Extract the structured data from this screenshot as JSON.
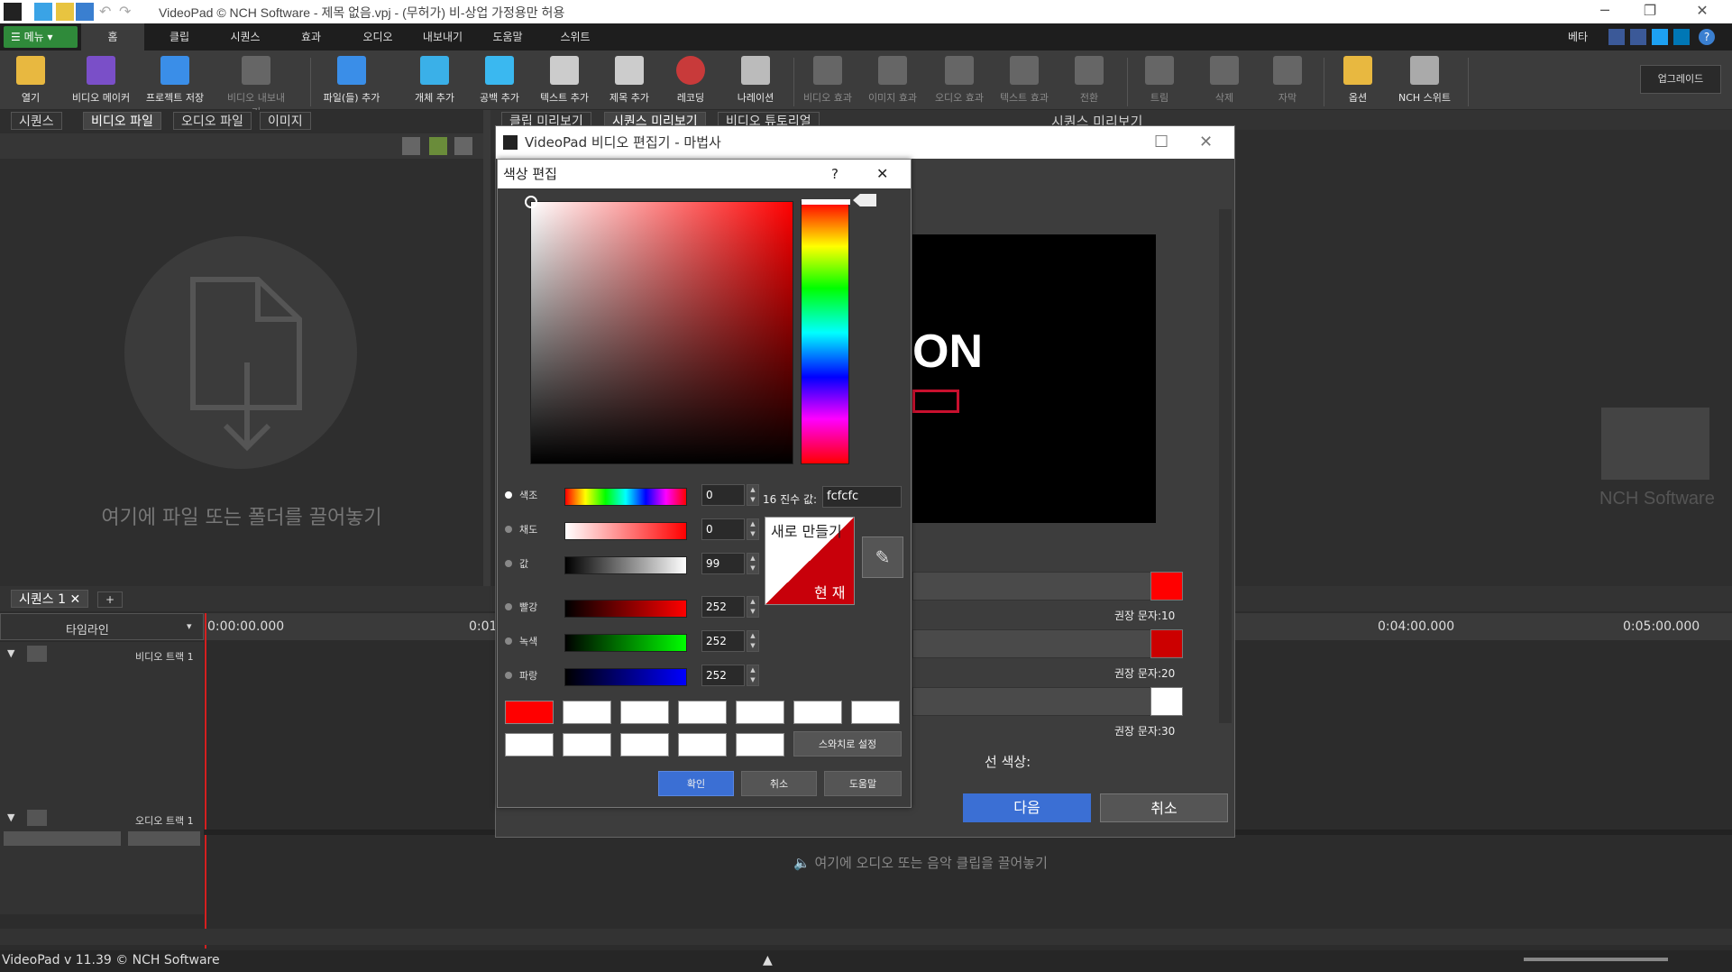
{
  "titlebar": {
    "title": "VideoPad © NCH Software - 제목 없음.vpj - (무허가) 비-상업 가정용만 허용"
  },
  "menu": {
    "label": "메뉴"
  },
  "tabs": [
    "홈",
    "클립",
    "시퀀스",
    "효과",
    "오디오",
    "내보내기",
    "도움말",
    "스위트"
  ],
  "header_right": {
    "beta": "베타"
  },
  "toolbar": {
    "items": [
      "열기",
      "비디오 메이커",
      "프로젝트 저장",
      "비디오 내보내기",
      "파일(들) 추가",
      "개체 추가",
      "공백 추가",
      "텍스트 추가",
      "제목 추가",
      "레코딩",
      "나레이션",
      "비디오 효과",
      "이미지 효과",
      "오디오 효과",
      "텍스트 효과",
      "전환",
      "트림",
      "삭제",
      "자막",
      "옵션",
      "NCH 스위트"
    ],
    "upgrade": "업그레이드"
  },
  "left_panel": {
    "tabs": [
      "시퀀스",
      "비디오 파일",
      "오디오 파일",
      "이미지"
    ],
    "drop_text": "여기에 파일 또는 폴더를 끌어놓기"
  },
  "right_panel": {
    "tabs": [
      "클립 미리보기",
      "시퀀스 미리보기",
      "비디오 튜토리얼"
    ],
    "title": "시퀀스 미리보기",
    "watermark": "NCH Software",
    "preview_text": "ON"
  },
  "timeline": {
    "tab": "시퀀스 1",
    "track_label": "타임라인",
    "ruler": [
      "0:00:00.000",
      "0:01",
      "0:04:00.000",
      "0:05:00.000"
    ],
    "video_track": "비디오 트랙 1",
    "audio_track": "오디오 트랙 1",
    "audio_drop": "여기에 오디오 또는 음악 클립을 끌어놓기"
  },
  "status": {
    "version": "VideoPad v 11.39 © NCH Software"
  },
  "wizard": {
    "title": "VideoPad 비디오 편집기 - 마법사",
    "captions": [
      "권장 문자:10",
      "권장 문자:20",
      "권장 문자:30"
    ],
    "line_color_label": "선 색상:",
    "next": "다음",
    "cancel": "취소",
    "colors": {
      "swatch1": "#ff0000",
      "swatch2": "#cc0000",
      "swatch3": "#ffffff",
      "next_bg": "#3b6fd4"
    }
  },
  "color_dialog": {
    "title": "색상 편집",
    "help": "?",
    "rows": [
      {
        "label": "색조",
        "value": "0"
      },
      {
        "label": "채도",
        "value": "0"
      },
      {
        "label": "값",
        "value": "99"
      },
      {
        "label": "빨강",
        "value": "252"
      },
      {
        "label": "녹색",
        "value": "252"
      },
      {
        "label": "파랑",
        "value": "252"
      }
    ],
    "hex_label": "16 진수 값:",
    "hex_value": "fcfcfc",
    "new_label": "새로 만들기",
    "current_label": "현 재",
    "set_swatch": "스와치로 설정",
    "ok": "확인",
    "cancel": "취소",
    "help_btn": "도움말",
    "swatches": [
      "#ff0000",
      "#ffffff",
      "#ffffff",
      "#ffffff",
      "#ffffff",
      "#ffffff",
      "#ffffff",
      "#ffffff",
      "#ffffff",
      "#ffffff",
      "#ffffff",
      "#ffffff"
    ]
  }
}
